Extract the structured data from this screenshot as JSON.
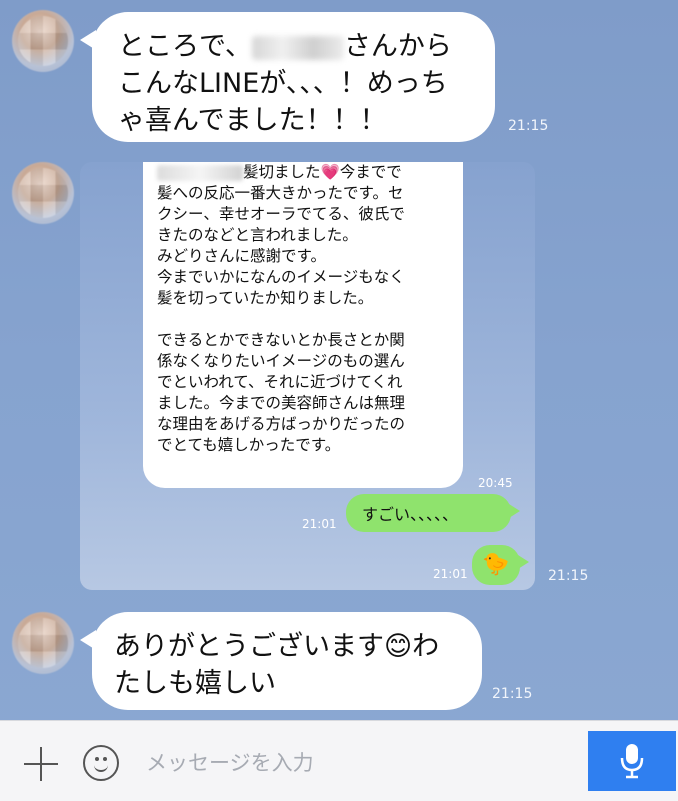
{
  "messages": {
    "first": {
      "text_before": "ところで、",
      "text_after": "さんからこんなLINEが、、、！めっちゃ喜んでました！！！",
      "time": "21:15"
    },
    "screenshot": {
      "time": "21:15",
      "received_lines": [
        "髪切ました💗今までで",
        "髪への反応一番大きかったです。セ",
        "クシー、幸せオーラでてる、彼氏で",
        "きたのなどと言われました。",
        "みどりさんに感謝です。",
        "今までいかになんのイメージもなく",
        "髪を切っていたか知りました。",
        "",
        "できるとかできないとか長さとか関",
        "係なくなりたいイメージのもの選ん",
        "でといわれて、それに近づけてくれ",
        "ました。今までの美容師さんは無理",
        "な理由をあげる方ばっかりだったの",
        "でとても嬉しかったです。"
      ],
      "received_time": "20:45",
      "sent_text": "すごい、、、、、",
      "sent_time": "21:01",
      "sticker_time": "21:01",
      "sticker_icon": "bird-sticker-icon"
    },
    "third": {
      "text_line1": "ありがとうございます",
      "emoji": "😊",
      "text_line1_after": "わ",
      "text_line2": "たしも嬉しい",
      "time": "21:15"
    }
  },
  "input_bar": {
    "placeholder": "メッセージを入力",
    "plus_icon": "plus-icon",
    "emoji_icon": "smiley-icon",
    "mic_icon": "microphone-icon"
  },
  "colors": {
    "background": "#86a3cf",
    "bubble": "#ffffff",
    "sent_bubble": "#8fe36d",
    "mic_button": "#2f7ff0"
  }
}
